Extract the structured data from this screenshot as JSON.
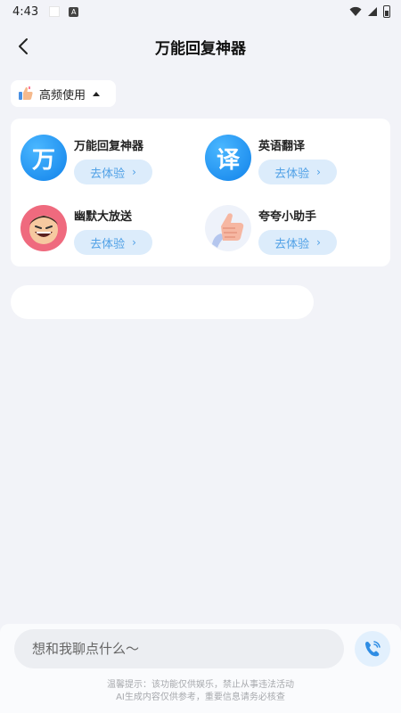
{
  "status_bar": {
    "time": "4:43",
    "notification_glyph": "A"
  },
  "header": {
    "title": "万能回复神器"
  },
  "filter": {
    "label": "高频使用"
  },
  "tools": [
    {
      "name": "万能回复神器",
      "avatar_char": "万",
      "button": "去体验"
    },
    {
      "name": "英语翻译",
      "avatar_char": "译",
      "button": "去体验"
    },
    {
      "name": "幽默大放送",
      "button": "去体验"
    },
    {
      "name": "夸夸小助手",
      "button": "去体验"
    }
  ],
  "input": {
    "placeholder": "想和我聊点什么～"
  },
  "disclaimer": {
    "line1": "温馨提示：该功能仅供娱乐，禁止从事违法活动",
    "line2": "AI生成内容仅供参考，重要信息请务必核查"
  },
  "colors": {
    "accent": "#4fa0e6",
    "button_bg": "#dcecfb",
    "brand_blue": "#1182ea",
    "background": "#f2f3f8"
  }
}
